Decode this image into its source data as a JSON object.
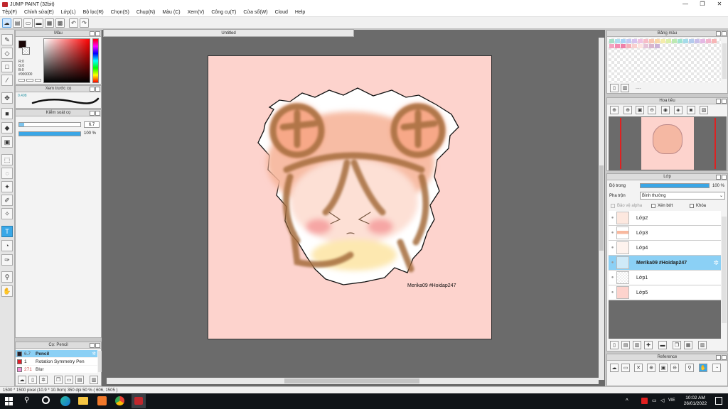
{
  "window": {
    "title": "JUMP PAINT (32bit)",
    "min": "—",
    "max": "❐",
    "close": "✕"
  },
  "menu": [
    "Tệp(F)",
    "Chỉnh sửa(E)",
    "Lớp(L)",
    "Bộ lọc(R)",
    "Chọn(S)",
    "Chụp(N)",
    "Màu (C)",
    "Xem(V)",
    "Công cụ(T)",
    "Cửa sổ(W)",
    "Cloud",
    "Help"
  ],
  "document": {
    "tab_title": "Untitled",
    "watermark": "Merika09 #Hoidap247"
  },
  "color_panel": {
    "title": "Màu",
    "r": "R:0",
    "g": "G:0",
    "b": "B:0",
    "hex": "#000000",
    "main_color": "#1a0606"
  },
  "brush_preview": {
    "title": "Xem trước cọ",
    "size": "0.498"
  },
  "brush_control": {
    "title": "Kiểm soát cọ",
    "size_value": "6.7",
    "opacity_value": "100 %"
  },
  "brush_list": {
    "title": "Cọ: Pencil",
    "items": [
      {
        "size": "6.7",
        "name": "Pencil",
        "color": "#1f1f2e",
        "selected": true
      },
      {
        "size": "1",
        "name": "Rotation Symmetry Pen",
        "color": "#e01e2a",
        "selected": false
      },
      {
        "size": "271",
        "name": "Blur",
        "color": "#f28bd6",
        "selected": false
      }
    ]
  },
  "palette": {
    "title": "Bảng màu",
    "dots": "...."
  },
  "navigator": {
    "title": "Hoa tiêu"
  },
  "layers_panel": {
    "title": "Lớp",
    "opacity_label": "Độ trong",
    "opacity_value": "100 %",
    "blend_label": "Pha trộn",
    "blend_value": "Bình thường",
    "protect_alpha": "Bảo vệ alpha",
    "clip": "Xén bớt",
    "lock": "Khóa",
    "layers": [
      {
        "name": "Lớp2",
        "selected": false
      },
      {
        "name": "Lớp3",
        "selected": false
      },
      {
        "name": "Lớp4",
        "selected": false
      },
      {
        "name": "Merika09 #Hoidap247",
        "selected": true
      },
      {
        "name": "Lớp1",
        "selected": false
      },
      {
        "name": "Lớp5",
        "selected": false
      }
    ]
  },
  "reference_panel": {
    "title": "Reference"
  },
  "status": {
    "text": "1500 * 1500 pixel  (10.9 * 10.9cm)  350 dpi  50 %  ( 606, 1505 )"
  },
  "taskbar": {
    "time": "10:02 AM",
    "date": "26/01/2022",
    "lang": "VIE"
  }
}
